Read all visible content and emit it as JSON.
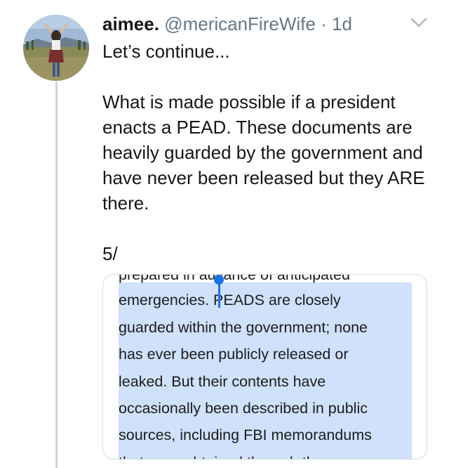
{
  "tweet": {
    "display_name": "aimee.",
    "handle": "@mericanFireWife",
    "separator": "·",
    "time": "1d",
    "menu_icon": "chevron-down-icon",
    "paragraphs": [
      "Let’s continue...",
      "What is made possible if a president enacts a PEAD. These documents are heavily guarded by the government and have never been released but they ARE there.",
      "5/"
    ]
  },
  "media": {
    "lines": [
      "prepared in advance of anticipated",
      "emergencies. PEADS are closely",
      "guarded within the government; none",
      "has ever been publicly released or",
      "leaked. But their contents have",
      "occasionally been described in public",
      "sources, including FBI memorandums",
      "that were obtained through the"
    ],
    "highlight_color": "#cfe1fb",
    "cursor_color": "#1a73e8"
  },
  "colors": {
    "name": "#14171a",
    "meta": "#657786",
    "thread_line": "#ccd6dd"
  }
}
